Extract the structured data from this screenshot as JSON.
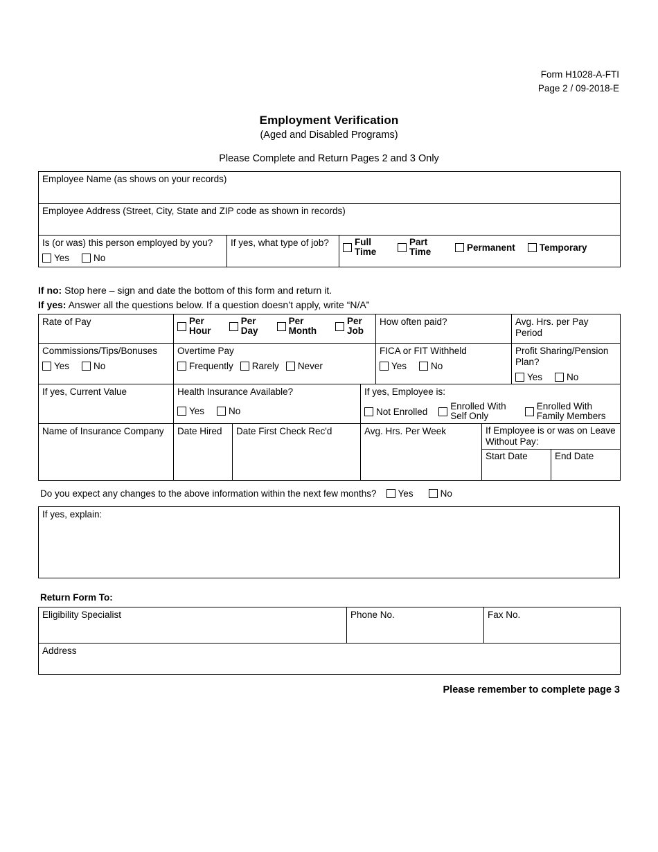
{
  "header": {
    "form_id": "Form H1028-A-FTI",
    "page_revision": "Page 2 / 09-2018-E"
  },
  "title": {
    "main": "Employment Verification",
    "sub": "(Aged and Disabled Programs)",
    "instruction": "Please Complete and Return Pages 2 and 3 Only"
  },
  "employee_section": {
    "name_label": "Employee Name (as shows on your records)",
    "address_label": "Employee Address (Street, City, State and ZIP code as shown in records)",
    "employed_label": "Is (or was) this person employed by you?",
    "employed_options": [
      "Yes",
      "No"
    ],
    "job_type_label": "If yes, what type of job?",
    "job_type_options": [
      "Full Time",
      "Part Time",
      "Permanent",
      "Temporary"
    ]
  },
  "notes": {
    "if_no_bold": "If no:",
    "if_no_text": " Stop here – sign and date the bottom of this form and return it.",
    "if_yes_bold": "If yes:",
    "if_yes_text": " Answer all the questions below. If a question doesn’t apply, write “N/A”"
  },
  "pay_section": {
    "rate_of_pay_label": "Rate of Pay",
    "rate_options": [
      "Per Hour",
      "Per Day",
      "Per Month",
      "Per Job"
    ],
    "how_often_paid_label": "How often paid?",
    "avg_hrs_pay_period_label": "Avg. Hrs. per Pay Period",
    "commissions_label": "Commissions/Tips/Bonuses",
    "commissions_options": [
      "Yes",
      "No"
    ],
    "overtime_label": "Overtime Pay",
    "overtime_options": [
      "Frequently",
      "Rarely",
      "Never"
    ],
    "fica_label": "FICA or FIT Withheld",
    "fica_options": [
      "Yes",
      "No"
    ],
    "profit_sharing_label": "Profit Sharing/Pension Plan?",
    "profit_sharing_options": [
      "Yes",
      "No"
    ],
    "current_value_label": "If yes, Current Value",
    "health_insurance_label": "Health Insurance Available?",
    "health_insurance_options": [
      "Yes",
      "No"
    ],
    "employee_is_label": "If yes, Employee is:",
    "enrollment_options": [
      "Not Enrolled",
      "Enrolled With Self Only",
      "Enrolled With Family Members"
    ],
    "insurance_company_label": "Name of Insurance Company",
    "date_hired_label": "Date Hired",
    "date_first_check_label": "Date First Check Rec'd",
    "avg_hrs_week_label": "Avg. Hrs. Per Week",
    "leave_without_pay_label": "If Employee is or was on Leave Without Pay:",
    "leave_start_label": "Start Date",
    "leave_end_label": "End Date"
  },
  "changes": {
    "question": "Do you expect any changes to the above information within the next few months?",
    "options": [
      "Yes",
      "No"
    ],
    "explain_label": "If yes, explain:"
  },
  "return_form": {
    "heading": "Return Form To:",
    "specialist_label": "Eligibility Specialist",
    "phone_label": "Phone No.",
    "fax_label": "Fax No.",
    "address_label": "Address"
  },
  "footer": {
    "reminder": "Please remember to complete page 3"
  }
}
